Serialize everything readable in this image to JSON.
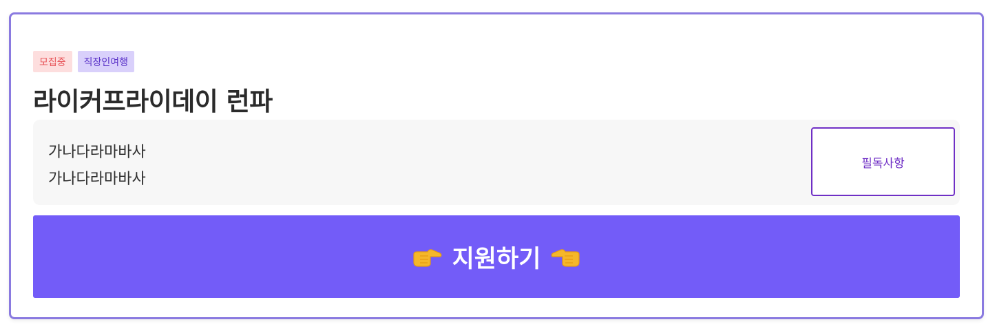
{
  "badges": {
    "recruiting": "모집중",
    "category": "직장인여행"
  },
  "trip": {
    "title": "라이커프라이데이 런파",
    "description_line1": "가나다라마바사",
    "description_line2": "가나다라마바사"
  },
  "notice_button": {
    "label": "필독사항"
  },
  "apply_button": {
    "label": "지원하기",
    "left_icon": "hand-pointing-right-icon",
    "right_icon": "hand-pointing-left-icon"
  },
  "colors": {
    "card_border": "#8a7ae0",
    "primary": "#735cf8",
    "notice_accent": "#6f2fc5",
    "recruiting_bg": "#fddede",
    "recruiting_text": "#e8555a",
    "category_bg": "#d9d0fb",
    "category_text": "#5a32c8"
  }
}
